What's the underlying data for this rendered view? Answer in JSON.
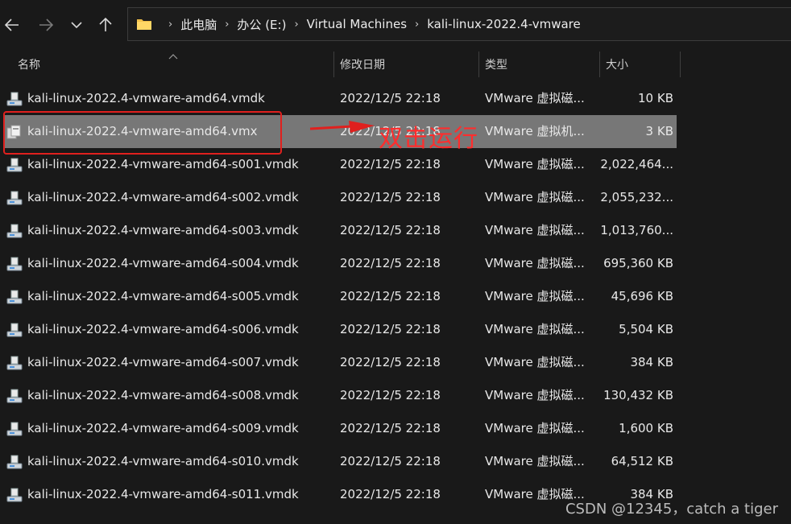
{
  "breadcrumb": [
    "此电脑",
    "办公 (E:)",
    "Virtual Machines",
    "kali-linux-2022.4-vmware"
  ],
  "columns": {
    "name": "名称",
    "modified": "修改日期",
    "type": "类型",
    "size": "大小"
  },
  "files": [
    {
      "name": "kali-linux-2022.4-vmware-amd64.vmdk",
      "modified": "2022/12/5 22:18",
      "type": "VMware 虚拟磁...",
      "size": "10 KB"
    },
    {
      "name": "kali-linux-2022.4-vmware-amd64.vmx",
      "modified": "2022/12/5 22:18",
      "type": "VMware 虚拟机...",
      "size": "3 KB"
    },
    {
      "name": "kali-linux-2022.4-vmware-amd64-s001.vmdk",
      "modified": "2022/12/5 22:18",
      "type": "VMware 虚拟磁...",
      "size": "2,022,464..."
    },
    {
      "name": "kali-linux-2022.4-vmware-amd64-s002.vmdk",
      "modified": "2022/12/5 22:18",
      "type": "VMware 虚拟磁...",
      "size": "2,055,232..."
    },
    {
      "name": "kali-linux-2022.4-vmware-amd64-s003.vmdk",
      "modified": "2022/12/5 22:18",
      "type": "VMware 虚拟磁...",
      "size": "1,013,760..."
    },
    {
      "name": "kali-linux-2022.4-vmware-amd64-s004.vmdk",
      "modified": "2022/12/5 22:18",
      "type": "VMware 虚拟磁...",
      "size": "695,360 KB"
    },
    {
      "name": "kali-linux-2022.4-vmware-amd64-s005.vmdk",
      "modified": "2022/12/5 22:18",
      "type": "VMware 虚拟磁...",
      "size": "45,696 KB"
    },
    {
      "name": "kali-linux-2022.4-vmware-amd64-s006.vmdk",
      "modified": "2022/12/5 22:18",
      "type": "VMware 虚拟磁...",
      "size": "5,504 KB"
    },
    {
      "name": "kali-linux-2022.4-vmware-amd64-s007.vmdk",
      "modified": "2022/12/5 22:18",
      "type": "VMware 虚拟磁...",
      "size": "384 KB"
    },
    {
      "name": "kali-linux-2022.4-vmware-amd64-s008.vmdk",
      "modified": "2022/12/5 22:18",
      "type": "VMware 虚拟磁...",
      "size": "130,432 KB"
    },
    {
      "name": "kali-linux-2022.4-vmware-amd64-s009.vmdk",
      "modified": "2022/12/5 22:18",
      "type": "VMware 虚拟磁...",
      "size": "1,600 KB"
    },
    {
      "name": "kali-linux-2022.4-vmware-amd64-s010.vmdk",
      "modified": "2022/12/5 22:18",
      "type": "VMware 虚拟磁...",
      "size": "64,512 KB"
    },
    {
      "name": "kali-linux-2022.4-vmware-amd64-s011.vmdk",
      "modified": "2022/12/5 22:18",
      "type": "VMware 虚拟磁...",
      "size": "384 KB"
    }
  ],
  "selected_index": 1,
  "annotation": {
    "text": "双击运行",
    "color": "#e0201e"
  },
  "watermark": "CSDN @12345，catch a tiger",
  "colors": {
    "background": "#191919",
    "selected_row": "#777777",
    "folder": "#f1c04b",
    "annotation": "#e0201e"
  },
  "icons": {
    "back": "arrow-left-icon",
    "forward": "arrow-right-icon",
    "recent": "chevron-down-icon",
    "up": "arrow-up-icon",
    "folder": "folder-icon",
    "vmdk": "disk-file-icon",
    "vmx": "vm-config-icon"
  }
}
